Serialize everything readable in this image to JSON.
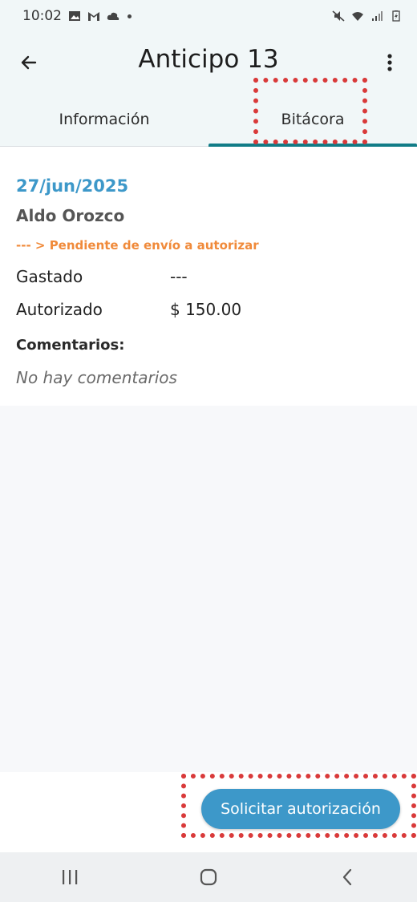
{
  "status_bar": {
    "time": "10:02",
    "icons_left": [
      "image-icon",
      "gmail-icon",
      "cloud-icon",
      "dot-icon"
    ],
    "icons_right": [
      "mute-icon",
      "wifi-icon",
      "signal-icon",
      "battery-icon"
    ]
  },
  "app_bar": {
    "title": "Anticipo 13",
    "back_icon": "arrow-left-icon",
    "more_icon": "more-vert-icon"
  },
  "tabs": [
    {
      "label": "Información",
      "selected": false
    },
    {
      "label": "Bitácora",
      "selected": true
    }
  ],
  "entry": {
    "date": "27/jun/2025",
    "name": "Aldo Orozco",
    "status": "--- > Pendiente de envío a autorizar",
    "rows": [
      {
        "label": "Gastado",
        "value": "---"
      },
      {
        "label": "Autorizado",
        "value": "$ 150.00"
      }
    ],
    "comments_label": "Comentarios:",
    "comments_empty": "No hay comentarios"
  },
  "actions": {
    "request_label": "Solicitar autorización"
  },
  "nav": [
    "recents-icon",
    "home-icon",
    "back-nav-icon"
  ],
  "colors": {
    "accent": "#3d98c9",
    "tab_indicator": "#117c87",
    "status_orange": "#f08a3a",
    "highlight_red": "#d93a3a"
  }
}
